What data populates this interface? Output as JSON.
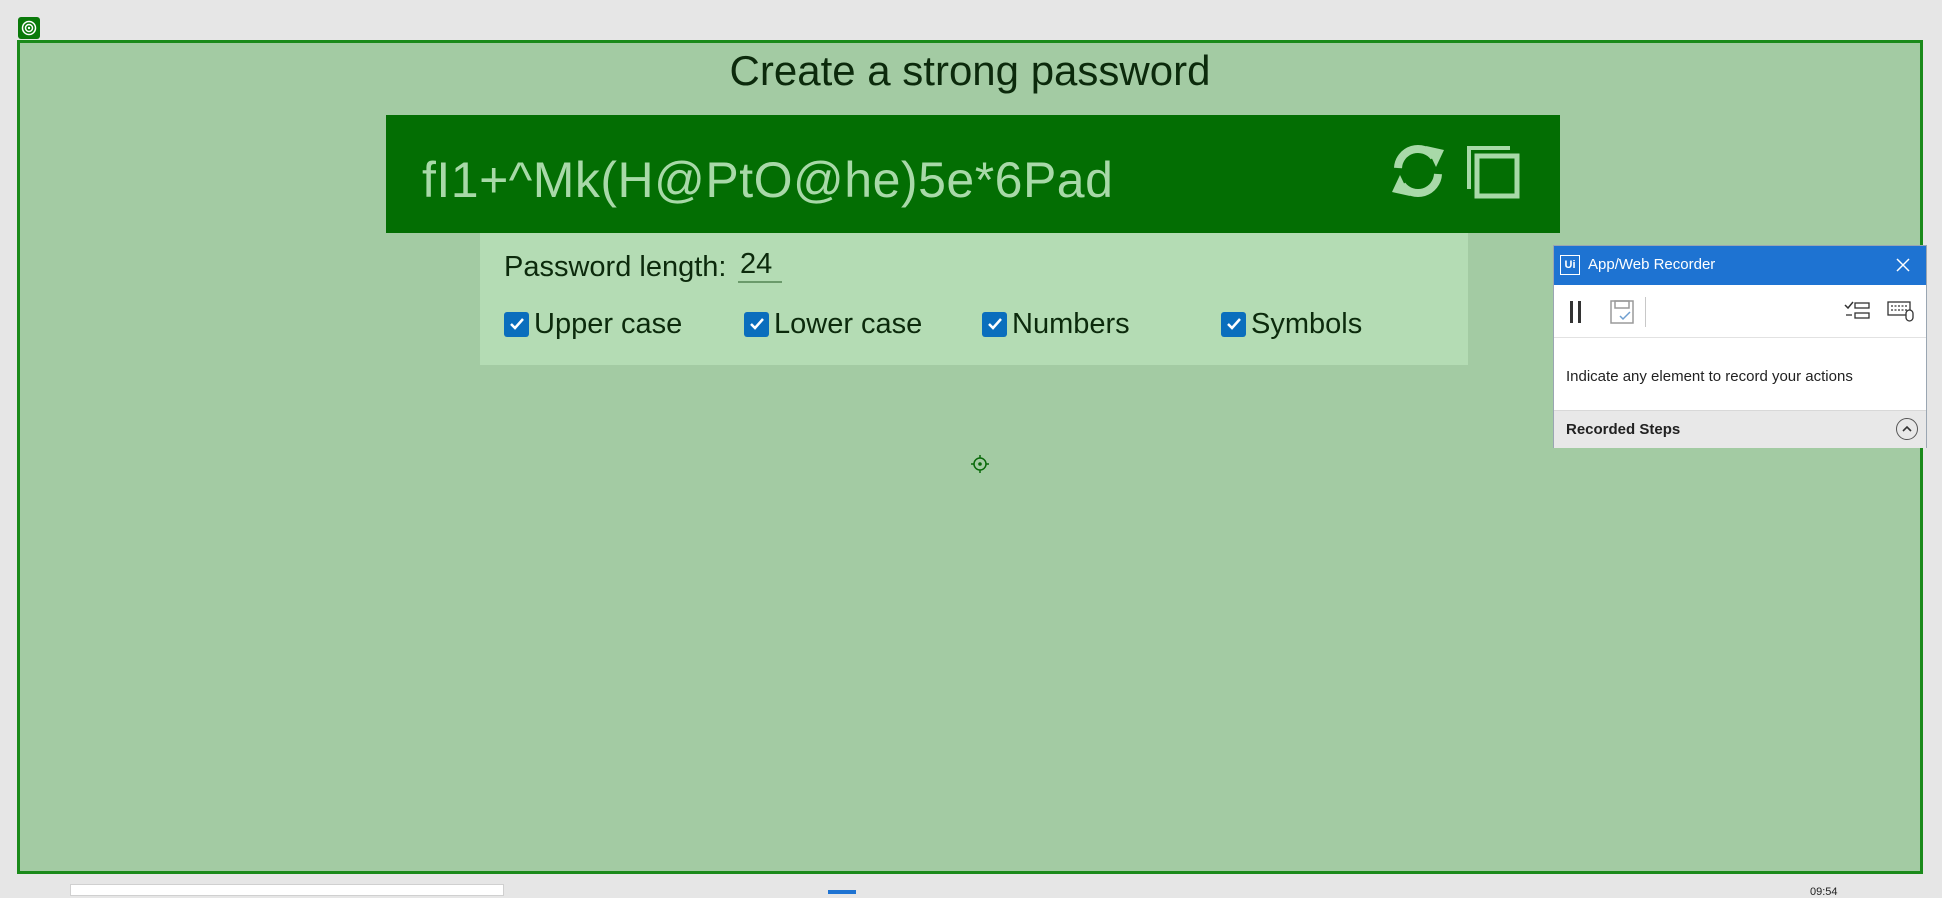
{
  "page": {
    "title": "Create a strong password"
  },
  "password": {
    "value": "fI1+^Mk(H@PtO@he)5e*6Pad"
  },
  "options": {
    "length_label": "Password length:",
    "length_value": "24",
    "checkboxes": [
      {
        "label": "Upper case",
        "checked": true
      },
      {
        "label": "Lower case",
        "checked": true
      },
      {
        "label": "Numbers",
        "checked": true
      },
      {
        "label": "Symbols",
        "checked": true
      }
    ]
  },
  "recorder": {
    "logo_text": "Ui",
    "title": "App/Web Recorder",
    "hint": "Indicate any element to record your actions",
    "steps_label": "Recorded Steps"
  },
  "taskbar": {
    "clock": "09:54"
  },
  "colors": {
    "overlay_bg": "#a3cba3",
    "password_bar": "#036e03",
    "options_bg": "#b4dcb4",
    "checkbox": "#0a6ebd",
    "recorder_header": "#1e73d2"
  }
}
